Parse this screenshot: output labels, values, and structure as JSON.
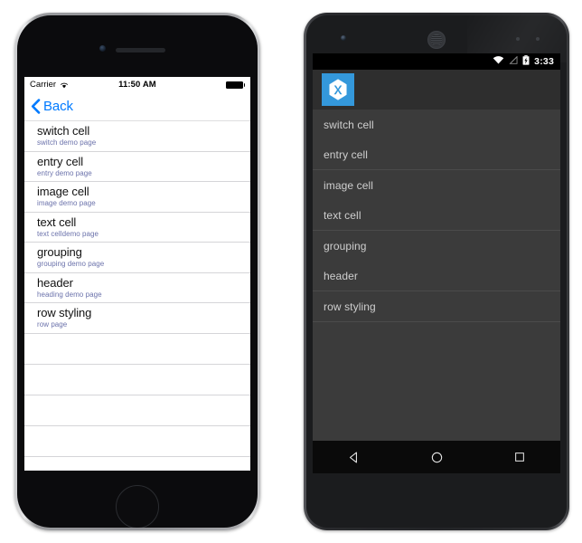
{
  "ios": {
    "device_name": "iPhone",
    "status": {
      "carrier": "Carrier",
      "wifi_icon": "wifi-icon",
      "time": "11:50 AM",
      "battery_icon": "battery-full-icon"
    },
    "nav": {
      "back_label": "Back",
      "back_chevron_icon": "chevron-left-icon"
    },
    "accent_color": "#007AFF",
    "detail_color": "#6B72AB",
    "list": [
      {
        "title": "switch cell",
        "detail": "switch demo page"
      },
      {
        "title": "entry cell",
        "detail": "entry demo page"
      },
      {
        "title": "image cell",
        "detail": "image demo page"
      },
      {
        "title": "text cell",
        "detail": "text celldemo page"
      },
      {
        "title": "grouping",
        "detail": "grouping demo page"
      },
      {
        "title": "header",
        "detail": "heading demo page"
      },
      {
        "title": "row styling",
        "detail": "row page"
      }
    ],
    "empty_rows": 4
  },
  "android": {
    "device_name": "Android",
    "status": {
      "wifi_icon": "wifi-icon",
      "signal_icon": "signal-no-service-icon",
      "battery_icon": "battery-charging-icon",
      "clock": "3:33"
    },
    "actionbar": {
      "app_icon": "xamarin-logo-icon",
      "app_icon_color": "#3498DB",
      "background_color": "#2E2E2E"
    },
    "list_background_color": "#3B3B3B",
    "text_color": "#CFCFCF",
    "list": [
      {
        "title": "switch cell",
        "separator_after": false
      },
      {
        "title": "entry cell",
        "separator_after": true
      },
      {
        "title": "image cell",
        "separator_after": false
      },
      {
        "title": "text cell",
        "separator_after": true
      },
      {
        "title": "grouping",
        "separator_after": false
      },
      {
        "title": "header",
        "separator_after": true
      },
      {
        "title": "row styling",
        "separator_after": false
      }
    ],
    "navbar": {
      "back_icon": "nav-back-triangle-icon",
      "home_icon": "nav-home-circle-icon",
      "recents_icon": "nav-recents-square-icon"
    }
  }
}
